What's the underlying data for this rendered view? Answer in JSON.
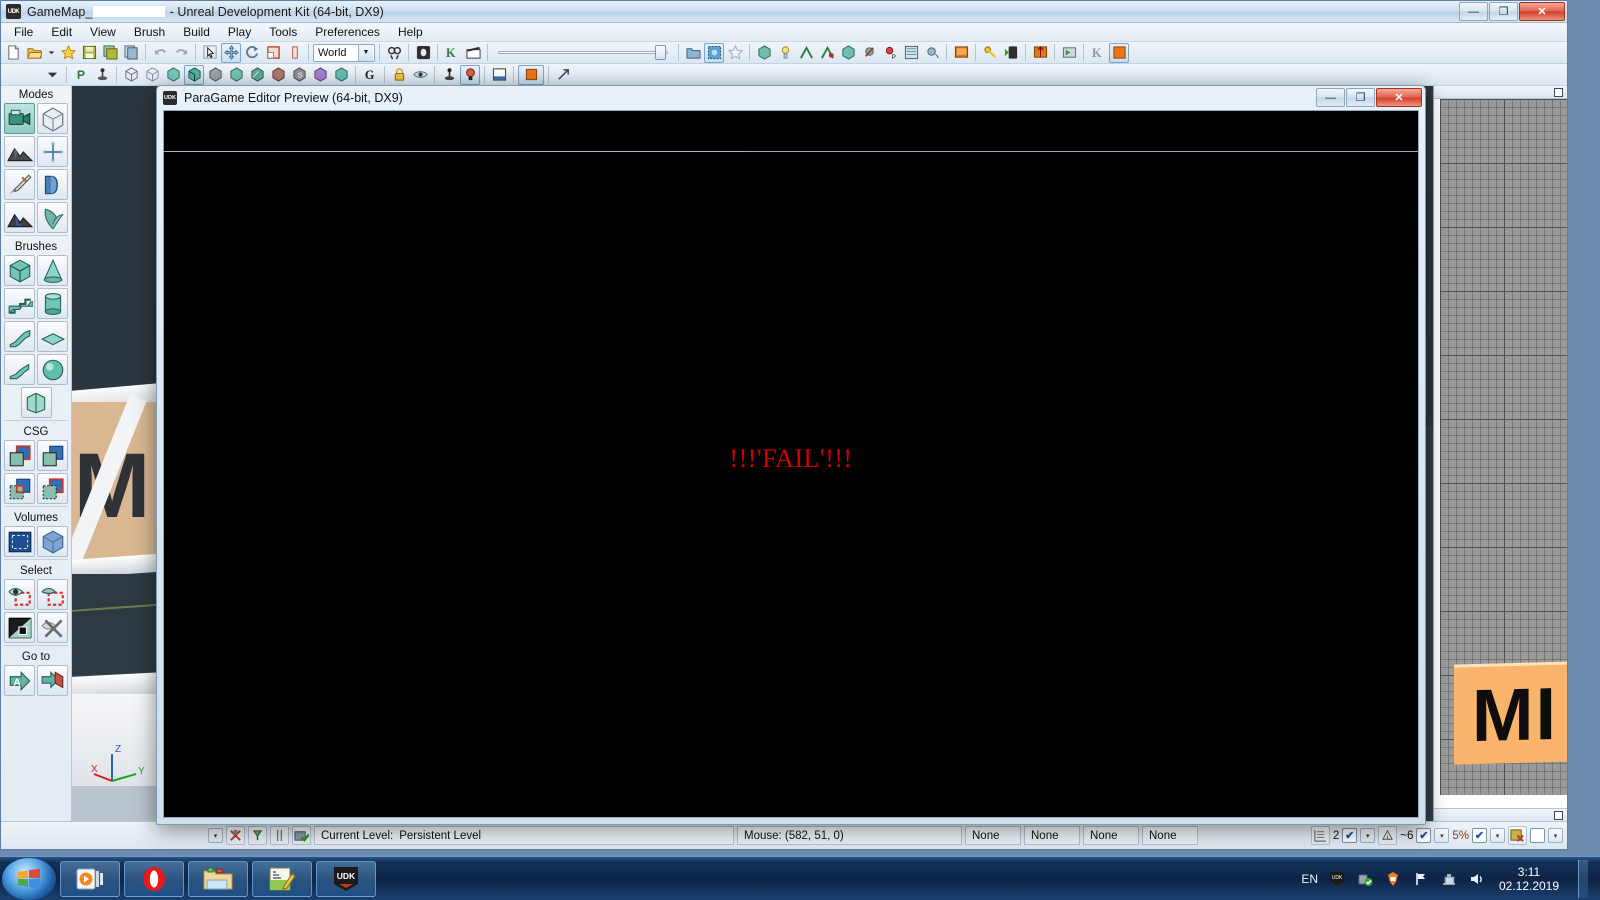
{
  "window": {
    "title_prefix": "GameMap_",
    "title_suffix": " - Unreal Development Kit (64-bit, DX9)",
    "app_icon": "udk-icon",
    "minimize": "—",
    "maximize": "❐",
    "close": "✕"
  },
  "menu": {
    "items": [
      {
        "label": "File"
      },
      {
        "label": "Edit"
      },
      {
        "label": "View"
      },
      {
        "label": "Brush"
      },
      {
        "label": "Build"
      },
      {
        "label": "Play"
      },
      {
        "label": "Tools"
      },
      {
        "label": "Preferences"
      },
      {
        "label": "Help"
      }
    ]
  },
  "toolbar_main": {
    "coord_system": "World",
    "groups": [
      {
        "buttons": [
          {
            "name": "new-file-icon"
          },
          {
            "name": "open-file-icon"
          },
          {
            "name": "open-recent-dropdown-icon"
          },
          {
            "name": "favorite-star-icon"
          },
          {
            "name": "save-icon"
          },
          {
            "name": "save-all-icon"
          },
          {
            "name": "save-copy-icon"
          }
        ]
      },
      {
        "buttons": [
          {
            "name": "undo-icon"
          },
          {
            "name": "redo-icon"
          }
        ]
      },
      {
        "buttons": [
          {
            "name": "select-tool-icon"
          },
          {
            "name": "translate-tool-icon"
          },
          {
            "name": "rotate-tool-icon"
          },
          {
            "name": "scale-tool-icon"
          },
          {
            "name": "nonuniform-scale-tool-icon"
          }
        ]
      },
      {
        "buttons": [
          {
            "name": "search-actors-icon"
          },
          {
            "name": "content-browser-icon"
          },
          {
            "name": "kismet-icon"
          },
          {
            "name": "matinee-icon"
          }
        ]
      },
      {
        "buttons": [
          {
            "name": "generic-browser-icon"
          },
          {
            "name": "actor-classes-icon"
          },
          {
            "name": "favorites-icon"
          },
          {
            "name": "build-geometry-icon"
          },
          {
            "name": "build-lighting-icon"
          },
          {
            "name": "build-paths-icon"
          },
          {
            "name": "build-ai-paths-icon"
          },
          {
            "name": "build-cover-icon"
          },
          {
            "name": "build-all-icon"
          },
          {
            "name": "lighting-quality-icon"
          },
          {
            "name": "lightmap-density-icon"
          },
          {
            "name": "sound-icon"
          },
          {
            "name": "play-in-editor-icon"
          },
          {
            "name": "play-on-pc-icon"
          },
          {
            "name": "play-on-mobile-icon"
          },
          {
            "name": "launch-icon"
          },
          {
            "name": "play-level-icon"
          },
          {
            "name": "kismet-open-icon"
          },
          {
            "name": "orange-swatch-icon"
          }
        ]
      }
    ]
  },
  "toolbar_view": {
    "buttons": [
      {
        "name": "modes-dropdown-icon"
      },
      {
        "name": "pivot-p-icon"
      },
      {
        "name": "joystick-icon"
      },
      {
        "name": "view-wireframe-icon"
      },
      {
        "name": "view-brush-wireframe-icon"
      },
      {
        "name": "view-unlit-icon"
      },
      {
        "name": "view-lit-icon"
      },
      {
        "name": "view-detail-lighting-icon"
      },
      {
        "name": "view-lighting-only-icon"
      },
      {
        "name": "view-light-complexity-icon"
      },
      {
        "name": "view-shader-complexity-icon"
      },
      {
        "name": "view-texture-density-icon"
      },
      {
        "name": "view-lightmap-density-icon"
      },
      {
        "name": "view-realtime-icon"
      },
      {
        "name": "game-view-g-icon"
      },
      {
        "name": "lock-icon"
      },
      {
        "name": "eye-show-icon"
      },
      {
        "name": "actor-pivot-icon"
      },
      {
        "name": "lighting-bulb-icon"
      },
      {
        "name": "viewport-layout-icon"
      },
      {
        "name": "orange-square-icon"
      },
      {
        "name": "maximize-viewport-icon"
      }
    ]
  },
  "modes_panel": {
    "sections": [
      {
        "title": "Modes",
        "buttons": [
          {
            "name": "mode-camera",
            "selected": true
          },
          {
            "name": "mode-geometry",
            "selected": false
          },
          {
            "name": "mode-terrain",
            "selected": false
          },
          {
            "name": "mode-texture-align",
            "selected": false
          },
          {
            "name": "mode-mesh-paint",
            "selected": false
          },
          {
            "name": "mode-static-mesh",
            "selected": false
          },
          {
            "name": "mode-landscape",
            "selected": false
          },
          {
            "name": "mode-foliage",
            "selected": false
          }
        ]
      },
      {
        "title": "Brushes",
        "buttons": [
          {
            "name": "brush-cube",
            "selected": false
          },
          {
            "name": "brush-cone",
            "selected": false
          },
          {
            "name": "brush-stairs",
            "selected": false
          },
          {
            "name": "brush-cylinder",
            "selected": false
          },
          {
            "name": "brush-curved-stairs",
            "selected": false
          },
          {
            "name": "brush-sheet",
            "selected": false
          },
          {
            "name": "brush-spiral-stairs",
            "selected": false
          },
          {
            "name": "brush-sphere",
            "selected": false
          },
          {
            "name": "brush-tessellated-plane",
            "selected": false
          }
        ]
      },
      {
        "title": "CSG",
        "buttons": [
          {
            "name": "csg-add",
            "selected": false
          },
          {
            "name": "csg-subtract",
            "selected": false
          },
          {
            "name": "csg-intersect",
            "selected": false
          },
          {
            "name": "csg-deintersect",
            "selected": false
          }
        ]
      },
      {
        "title": "Volumes",
        "buttons": [
          {
            "name": "volume-add",
            "selected": false
          },
          {
            "name": "volume-type",
            "selected": false
          }
        ]
      },
      {
        "title": "Select",
        "buttons": [
          {
            "name": "select-all",
            "selected": false
          },
          {
            "name": "select-none",
            "selected": false
          },
          {
            "name": "select-invert",
            "selected": false
          },
          {
            "name": "select-clear",
            "selected": false
          }
        ]
      },
      {
        "title": "Go to",
        "buttons": [
          {
            "name": "goto-actor",
            "selected": false
          },
          {
            "name": "goto-bookmark",
            "selected": false
          }
        ]
      }
    ]
  },
  "viewport_right": {
    "tile_label": "MI"
  },
  "viewport_persp": {
    "axis_x": "X",
    "axis_y": "Y",
    "axis_z": "Z",
    "wall_label": "M"
  },
  "preview_window": {
    "title": "ParaGame Editor Preview (64-bit, DX9)",
    "icon": "udk-icon",
    "minimize": "—",
    "restore": "❐",
    "close": "✕",
    "message": "!!!'FAIL'!!!",
    "message_color": "#d40000"
  },
  "status_bar": {
    "current_level_label": "Current Level:",
    "current_level_value": "Persistent Level",
    "mouse_label": "Mouse: (582, 51, 0)",
    "none_panels": [
      "None",
      "None",
      "None",
      "None"
    ],
    "grid_value": "2",
    "angle_value": "~6",
    "zoom_value": "5%",
    "check_glyph": "✔",
    "drop_glyph": "▾"
  },
  "taskbar": {
    "start": "start-orb",
    "tasks": [
      {
        "name": "media-player-task"
      },
      {
        "name": "opera-browser-task"
      },
      {
        "name": "file-explorer-task"
      },
      {
        "name": "notepadpp-task"
      },
      {
        "name": "udk-task",
        "label": "UDK"
      }
    ],
    "tray": {
      "language": "EN",
      "icons": [
        {
          "name": "udk-tray-icon"
        },
        {
          "name": "safely-remove-hardware-icon"
        },
        {
          "name": "antivirus-tray-icon"
        },
        {
          "name": "network-flag-icon"
        },
        {
          "name": "network-computer-icon"
        },
        {
          "name": "volume-icon"
        }
      ],
      "time": "3:11",
      "date": "02.12.2019"
    }
  },
  "colors": {
    "accent": "#1c5fa8",
    "fail_red": "#d40000",
    "tile_orange": "#f7b46a",
    "selected_mode": "#8fcbc4"
  }
}
